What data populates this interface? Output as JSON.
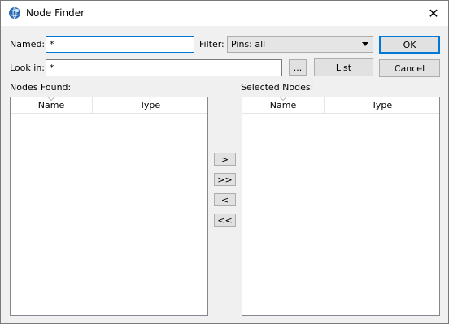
{
  "window": {
    "title": "Node Finder",
    "close_glyph": "✕"
  },
  "form": {
    "named_label": "Named:",
    "named_value": "*",
    "filter_label": "Filter:",
    "filter_value": "Pins: all",
    "lookin_label": "Look in:",
    "lookin_value": "*",
    "browse_label": "...",
    "list_label": "List",
    "ok_label": "OK",
    "cancel_label": "Cancel"
  },
  "nodes_found": {
    "label": "Nodes Found:",
    "columns": [
      "Name",
      "Type"
    ],
    "rows": []
  },
  "selected_nodes": {
    "label": "Selected Nodes:",
    "columns": [
      "Name",
      "Type"
    ],
    "rows": []
  },
  "move_buttons": {
    "add": ">",
    "add_all": ">>",
    "remove": "<",
    "remove_all": "<<"
  },
  "colors": {
    "accent": "#0078d7",
    "button_face": "#e1e1e1",
    "window_bg": "#f0f0f0"
  },
  "icons": {
    "app": "node-finder-globe-icon",
    "close": "close-icon",
    "dropdown": "chevron-down-icon",
    "sort": "sort-caret-icon"
  }
}
